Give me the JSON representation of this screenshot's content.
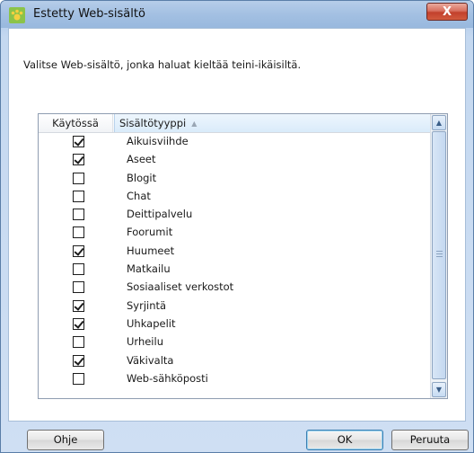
{
  "window": {
    "title": "Estetty Web-sisältö",
    "close_label": "X"
  },
  "instruction": "Valitse Web-sisältö, jonka haluat kieltää teini-ikäisiltä.",
  "table": {
    "columns": [
      "Käytössä",
      "Sisältötyyppi"
    ],
    "sort_icon": "sort-ascending-icon",
    "rows": [
      {
        "label": "Aikuisviihde",
        "checked": true
      },
      {
        "label": "Aseet",
        "checked": true
      },
      {
        "label": "Blogit",
        "checked": false
      },
      {
        "label": "Chat",
        "checked": false
      },
      {
        "label": "Deittipalvelu",
        "checked": false
      },
      {
        "label": "Foorumit",
        "checked": false
      },
      {
        "label": "Huumeet",
        "checked": true
      },
      {
        "label": "Matkailu",
        "checked": false
      },
      {
        "label": "Sosiaaliset verkostot",
        "checked": false
      },
      {
        "label": "Syrjintä",
        "checked": true
      },
      {
        "label": "Uhkapelit",
        "checked": true
      },
      {
        "label": "Urheilu",
        "checked": false
      },
      {
        "label": "Väkivalta",
        "checked": true
      },
      {
        "label": "Web-sähköposti",
        "checked": false
      }
    ]
  },
  "buttons": {
    "help": "Ohje",
    "ok": "OK",
    "cancel": "Peruuta"
  }
}
